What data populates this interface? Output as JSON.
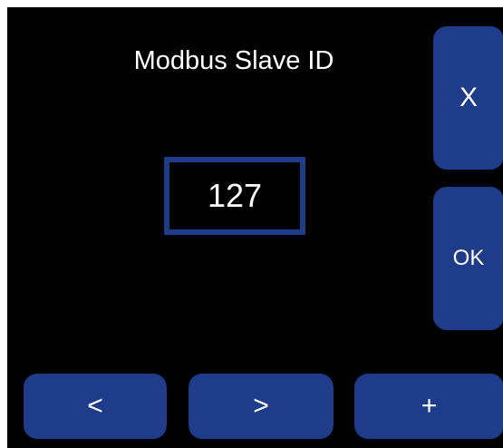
{
  "title": "Modbus Slave ID",
  "value": "127",
  "buttons": {
    "cancel_label": "X",
    "ok_label": "OK",
    "prev_label": "<",
    "next_label": ">",
    "increment_label": "+"
  },
  "colors": {
    "background": "#000000",
    "accent": "#1e3c8a",
    "text": "#ffffff"
  }
}
